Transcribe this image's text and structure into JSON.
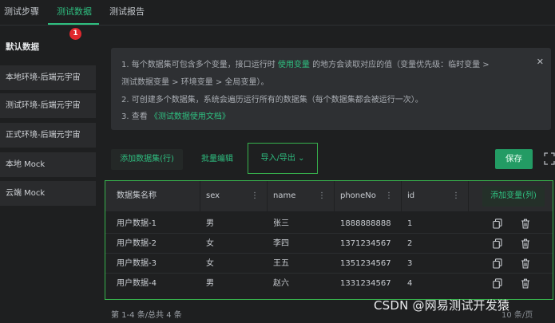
{
  "tabs": [
    {
      "label": "测试步骤"
    },
    {
      "label": "测试数据"
    },
    {
      "label": "测试报告"
    }
  ],
  "badge": "1",
  "sidebar": {
    "heading": "默认数据",
    "items": [
      {
        "label": "本地环境-后端元宇宙"
      },
      {
        "label": "测试环境-后端元宇宙"
      },
      {
        "label": "正式环境-后端元宇宙"
      },
      {
        "label": "本地 Mock"
      },
      {
        "label": "云端 Mock"
      }
    ]
  },
  "info": {
    "line1_a": "1. 每个数据集可包含多个变量，接口运行时",
    "line1_link": "使用变量",
    "line1_b": "的地方会读取对应的值（变量优先级：临时变量 >",
    "line2": "测试数据变量 > 环境变量 > 全局变量）。",
    "line3": "2. 可创建多个数据集，系统会遍历运行所有的数据集（每个数据集都会被运行一次）。",
    "line4_a": "3. 查看",
    "line4_link": "《测试数据使用文档》",
    "close": "✕"
  },
  "toolbar": {
    "add_dataset": "添加数据集(行)",
    "batch_edit": "批量编辑",
    "import_export": "导入/导出",
    "import_export_caret": "⌄",
    "save": "保存"
  },
  "table": {
    "columns": [
      "数据集名称",
      "sex",
      "name",
      "phoneNo",
      "id"
    ],
    "add_column": "添加变量(列)",
    "rows": [
      {
        "dataset": "用户数据-1",
        "sex": "男",
        "name": "张三",
        "phone": "1888888888",
        "id": "1"
      },
      {
        "dataset": "用户数据-2",
        "sex": "女",
        "name": "李四",
        "phone": "1371234567",
        "id": "2"
      },
      {
        "dataset": "用户数据-3",
        "sex": "女",
        "name": "王五",
        "phone": "1351234567",
        "id": "3"
      },
      {
        "dataset": "用户数据-4",
        "sex": "男",
        "name": "赵六",
        "phone": "1331234567",
        "id": "4"
      }
    ]
  },
  "pager": {
    "summary": "第 1-4 条/总共 4 条",
    "page_size": "10 条/页"
  },
  "watermark": "CSDN @网易测试开发猿",
  "colors": {
    "accent": "#2fbf80",
    "border_highlight": "#37b24d",
    "badge": "#e0282e"
  }
}
